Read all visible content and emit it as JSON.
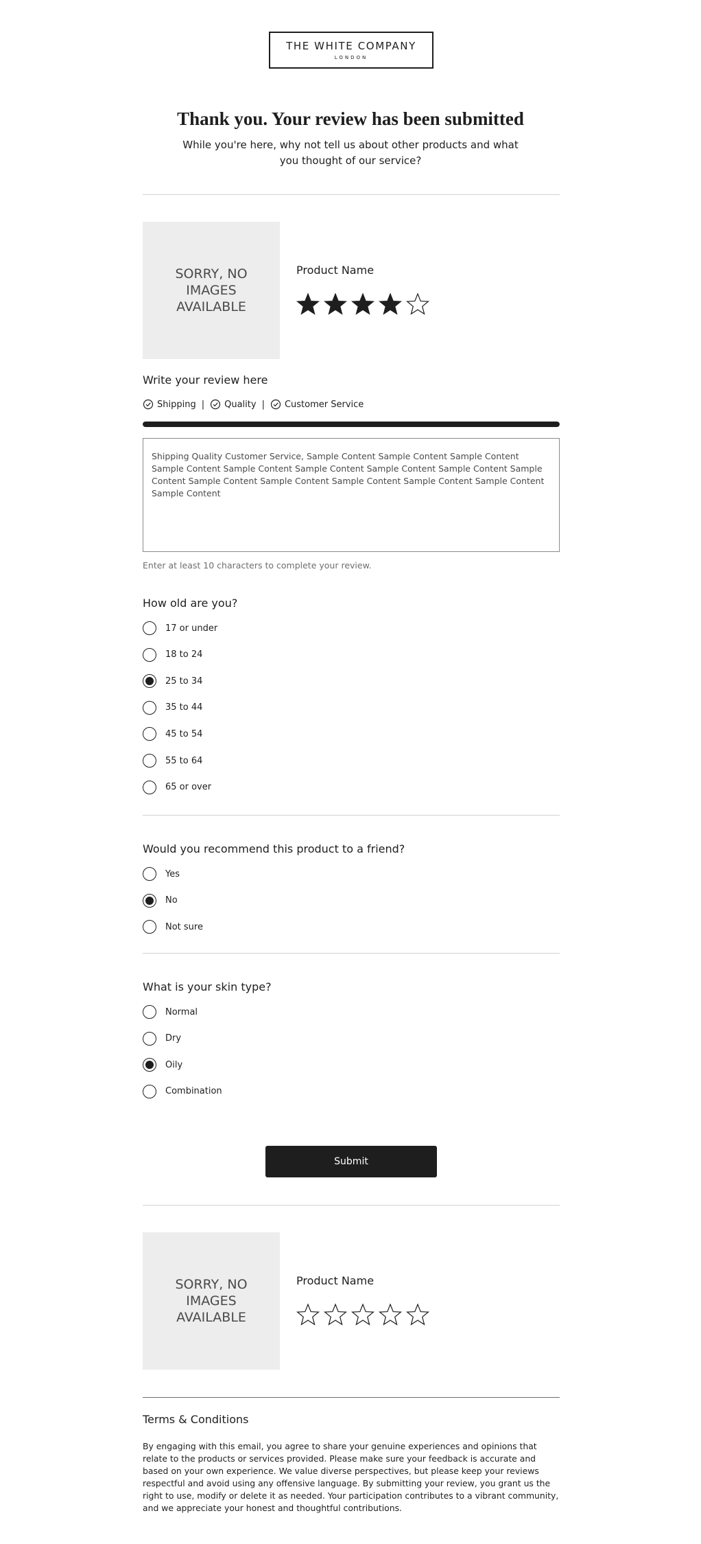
{
  "brand": {
    "name": "THE WHITE COMPANY",
    "sub": "LONDON"
  },
  "confirmation": {
    "title": "Thank you. Your review has been submitted",
    "subtitle": "While you're here, why not tell us about other products and what you thought of our service?"
  },
  "products": [
    {
      "image_text": "SORRY, NO IMAGES AVAILABLE",
      "name": "Product Name",
      "rating": 4,
      "max_rating": 5
    },
    {
      "image_text": "SORRY, NO IMAGES AVAILABLE",
      "name": "Product Name",
      "rating": 0,
      "max_rating": 5
    }
  ],
  "review": {
    "label": "Write your review here",
    "tags": [
      "Shipping",
      "Quality",
      "Customer Service"
    ],
    "progress": 1.0,
    "text": "Shipping Quality Customer Service, Sample Content Sample Content Sample Content Sample Content Sample Content Sample Content Sample Content Sample Content Sample Content Sample Content Sample Content Sample Content Sample Content Sample Content Sample Content",
    "hint": "Enter at least 10 characters to complete your review."
  },
  "age_question": {
    "label": "How old are you?",
    "options": [
      "17 or under",
      "18 to 24",
      "25 to 34",
      "35 to 44",
      "45 to 54",
      "55 to 64",
      "65 or over"
    ],
    "selected": "25 to 34"
  },
  "recommend_question": {
    "label": "Would you recommend this product to a friend?",
    "options": [
      "Yes",
      "No",
      "Not sure"
    ],
    "selected": "No"
  },
  "skin_question": {
    "label": "What is your skin type?",
    "options": [
      "Normal",
      "Dry",
      "Oily",
      "Combination"
    ],
    "selected": "Oily"
  },
  "submit_label": "Submit",
  "terms": {
    "title": "Terms & Conditions",
    "body": "By engaging with this email, you agree to share your genuine experiences and opinions that relate to the products or services provided. Please make sure your feedback is accurate and based on your own experience. We value diverse perspectives, but please keep your reviews respectful and avoid using any offensive language. By submitting your review, you grant us the right to use, modify or delete it as needed. Your participation contributes to a vibrant community, and we appreciate your honest and thoughtful contributions."
  },
  "colors": {
    "text": "#1e1e1e",
    "button": "#1e1e1e",
    "placeholder_bg": "#ededed",
    "divider": "#d2d2d2"
  },
  "icons": {
    "tag": "check-circle-icon",
    "star_filled": "star-filled-icon",
    "star_empty": "star-outline-icon"
  }
}
